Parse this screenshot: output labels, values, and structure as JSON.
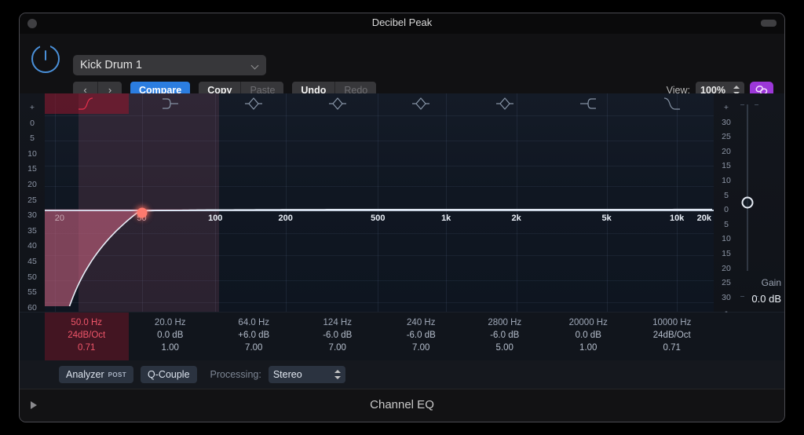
{
  "window": {
    "title": "Decibel Peak",
    "close_dot": "window-dot",
    "resize_pill": "window-pill"
  },
  "header": {
    "power_icon": "power-icon",
    "preset_name": "Kick Drum 1",
    "preset_caret_icon": "chevron-down-icon",
    "prev_label": "‹",
    "next_label": "›",
    "compare_label": "Compare",
    "copy_label": "Copy",
    "paste_label": "Paste",
    "undo_label": "Undo",
    "redo_label": "Redo",
    "view_label": "View:",
    "view_value": "100%",
    "view_stepper_icon": "up-down-stepper-icon",
    "link_icon": "link-chain-icon",
    "link_color": "#9c37d8",
    "compare_color": "#2b7de0"
  },
  "analyzer_scale_left": [
    "+",
    "0",
    "5",
    "10",
    "15",
    "20",
    "25",
    "30",
    "35",
    "40",
    "45",
    "50",
    "55",
    "60"
  ],
  "gain_scale_right": [
    "+",
    "30",
    "25",
    "20",
    "15",
    "10",
    "5",
    "0",
    "5",
    "10",
    "15",
    "20",
    "25",
    "30",
    "-"
  ],
  "gain": {
    "label": "Gain",
    "value": "0.0 dB",
    "knob_icon": "gain-knob-icon"
  },
  "frequency_axis": {
    "labels": [
      "20",
      "50",
      "100",
      "200",
      "500",
      "1k",
      "2k",
      "5k",
      "10k",
      "20k"
    ],
    "positions_pct": [
      1.5,
      14.5,
      25.5,
      36.0,
      49.8,
      60.0,
      70.5,
      84.0,
      94.5,
      104.0
    ]
  },
  "bands": [
    {
      "icon": "highpass-filter-icon",
      "type": "highpass",
      "freq": "50.0 Hz",
      "gain": "24dB/Oct",
      "q": "0.71",
      "active": true
    },
    {
      "icon": "lowshelf-filter-icon",
      "type": "lowshelf",
      "freq": "20.0 Hz",
      "gain": "0.0 dB",
      "q": "1.00",
      "active": false
    },
    {
      "icon": "bell-filter-icon",
      "type": "bell",
      "freq": "64.0 Hz",
      "gain": "+6.0 dB",
      "q": "7.00",
      "active": false
    },
    {
      "icon": "bell-filter-icon",
      "type": "bell",
      "freq": "124 Hz",
      "gain": "-6.0 dB",
      "q": "7.00",
      "active": false
    },
    {
      "icon": "bell-filter-icon",
      "type": "bell",
      "freq": "240 Hz",
      "gain": "-6.0 dB",
      "q": "7.00",
      "active": false
    },
    {
      "icon": "bell-filter-icon",
      "type": "bell",
      "freq": "2800 Hz",
      "gain": "-6.0 dB",
      "q": "5.00",
      "active": false
    },
    {
      "icon": "highshelf-filter-icon",
      "type": "highshelf",
      "freq": "20000 Hz",
      "gain": "0.0 dB",
      "q": "1.00",
      "active": false
    },
    {
      "icon": "lowpass-filter-icon",
      "type": "lowpass",
      "freq": "10000 Hz",
      "gain": "24dB/Oct",
      "q": "0.71",
      "active": false
    }
  ],
  "curve": {
    "description": "high-pass 24dB/Oct at 50 Hz, flat above",
    "fill_color": "#c1607c",
    "line_color": "#e8eef7",
    "handle_color": "#ff7a6e",
    "handle_freq_pct": 14.5
  },
  "tools": {
    "analyzer_label": "Analyzer",
    "analyzer_mode": "POST",
    "qcouple_label": "Q-Couple",
    "processing_label": "Processing:",
    "processing_value": "Stereo",
    "processing_stepper_icon": "up-down-stepper-icon"
  },
  "footer": {
    "disclosure_icon": "disclosure-triangle-icon",
    "plugin_name": "Channel EQ"
  }
}
